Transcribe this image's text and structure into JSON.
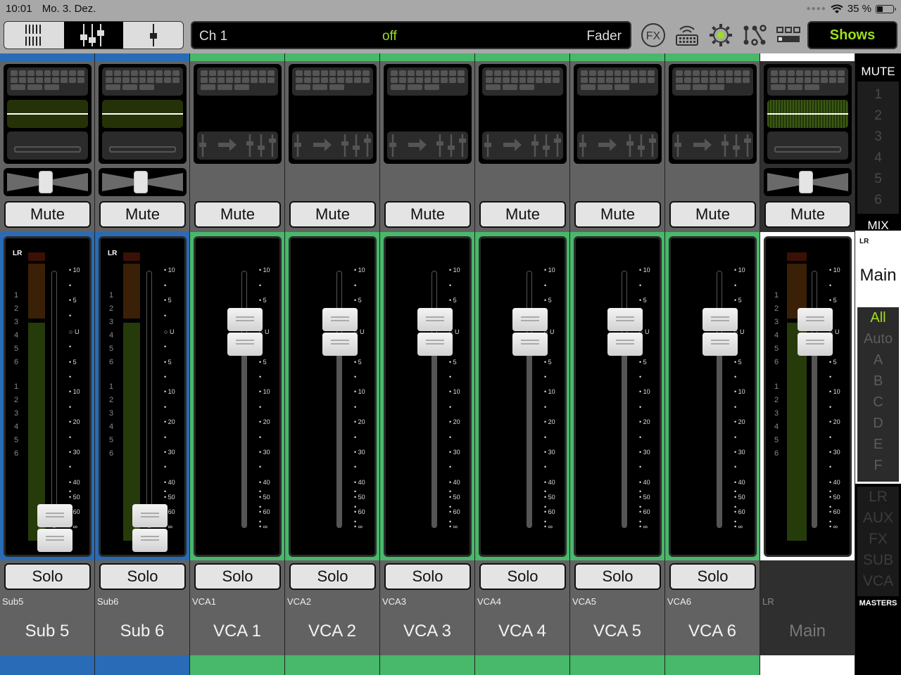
{
  "status_bar": {
    "time": "10:01",
    "date": "Mo. 3. Dez.",
    "battery": "35 %",
    "battery_level": 0.35
  },
  "toolbar": {
    "view_modes": [
      {
        "name": "overview",
        "active": false
      },
      {
        "name": "mixer",
        "active": true
      },
      {
        "name": "single-channel",
        "active": false
      }
    ],
    "channel_name": "Ch 1",
    "channel_state": "off",
    "channel_mode": "Fader",
    "icons": [
      "fx-icon",
      "wifi-keyboard-icon",
      "settings-gear-icon",
      "patch-routing-icon",
      "layout-icon"
    ],
    "shows_label": "Shows"
  },
  "colors": {
    "sub": "#2a6bb7",
    "vca": "#48b86a",
    "main": "#ffffff",
    "accent": "#9cde1c"
  },
  "channels": [
    {
      "short": "Sub5",
      "long": "Sub 5",
      "group": "sub",
      "type": "sub",
      "mute": "Mute",
      "solo": "Solo",
      "fader_db": "-∞",
      "pan": 0
    },
    {
      "short": "Sub6",
      "long": "Sub 6",
      "group": "sub",
      "type": "sub",
      "mute": "Mute",
      "solo": "Solo",
      "fader_db": "-∞",
      "pan": 0
    },
    {
      "short": "VCA1",
      "long": "VCA 1",
      "group": "vca",
      "type": "vca",
      "mute": "Mute",
      "solo": "Solo",
      "fader_db": "0 (U)"
    },
    {
      "short": "VCA2",
      "long": "VCA 2",
      "group": "vca",
      "type": "vca",
      "mute": "Mute",
      "solo": "Solo",
      "fader_db": "0 (U)"
    },
    {
      "short": "VCA3",
      "long": "VCA 3",
      "group": "vca",
      "type": "vca",
      "mute": "Mute",
      "solo": "Solo",
      "fader_db": "0 (U)"
    },
    {
      "short": "VCA4",
      "long": "VCA 4",
      "group": "vca",
      "type": "vca",
      "mute": "Mute",
      "solo": "Solo",
      "fader_db": "0 (U)"
    },
    {
      "short": "VCA5",
      "long": "VCA 5",
      "group": "vca",
      "type": "vca",
      "mute": "Mute",
      "solo": "Solo",
      "fader_db": "0 (U)"
    },
    {
      "short": "VCA6",
      "long": "VCA 6",
      "group": "vca",
      "type": "vca",
      "mute": "Mute",
      "solo": "Solo",
      "fader_db": "0 (U)"
    },
    {
      "short": "LR",
      "long": "Main",
      "group": "main",
      "type": "main",
      "mute": "Mute",
      "solo": "",
      "fader_db": "0 (U)",
      "pan": 0
    }
  ],
  "fader_scale": [
    "10",
    "",
    "5",
    "",
    "U",
    "",
    "5",
    "",
    "10",
    "",
    "20",
    "",
    "30",
    "",
    "40",
    "",
    "50",
    "",
    "60",
    "",
    "∞"
  ],
  "meter_labels": {
    "lr": "LR",
    "upper": [
      "1",
      "2",
      "3",
      "4",
      "5",
      "6"
    ],
    "lower": [
      "1",
      "2",
      "3",
      "4",
      "5",
      "6"
    ]
  },
  "sidebar": {
    "mute_header": "MUTE",
    "mute_groups": [
      "1",
      "2",
      "3",
      "4",
      "5",
      "6"
    ],
    "mix_header": "MIX",
    "mix_sub": "LR",
    "mix_name": "Main",
    "filters": [
      {
        "label": "All",
        "active": true
      },
      {
        "label": "Auto"
      },
      {
        "label": "A"
      },
      {
        "label": "B"
      },
      {
        "label": "C"
      },
      {
        "label": "D"
      },
      {
        "label": "E"
      },
      {
        "label": "F"
      }
    ],
    "masters": [
      "LR",
      "AUX",
      "FX",
      "SUB",
      "VCA"
    ],
    "masters_header": "MASTERS"
  }
}
